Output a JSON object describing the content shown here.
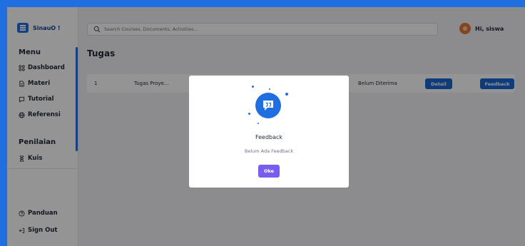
{
  "app": {
    "logo_text": "SinauO !"
  },
  "sidebar": {
    "menu_heading": "Menu",
    "items": [
      {
        "label": "Dashboard",
        "icon": "grid-icon"
      },
      {
        "label": "Materi",
        "icon": "document-icon"
      },
      {
        "label": "Tutorial",
        "icon": "chat-icon"
      },
      {
        "label": "Referensi",
        "icon": "globe-icon"
      }
    ],
    "assessment_heading": "Penilaian",
    "assessment_items": [
      {
        "label": "Kuis",
        "icon": "hourglass-icon"
      }
    ],
    "footer_items": [
      {
        "label": "Panduan",
        "icon": "help-icon"
      },
      {
        "label": "Sign Out",
        "icon": "logout-icon"
      }
    ]
  },
  "search": {
    "placeholder": "Search Courses, Documents, Activities..."
  },
  "user": {
    "greeting": "Hi, siswa"
  },
  "page": {
    "title": "Tugas"
  },
  "tasks": [
    {
      "number": "1",
      "name": "Tugas Proye...",
      "status": "Belum Diterima",
      "detail_label": "Detail",
      "feedback_label": "Feedback"
    }
  ],
  "modal": {
    "icon": "speech-bubble-icon",
    "title": "Feedback",
    "message": "Belum Ada Feedback",
    "ok_label": "Oke"
  },
  "colors": {
    "primary": "#1f6fe0",
    "ok_button": "#7b5cf0"
  }
}
